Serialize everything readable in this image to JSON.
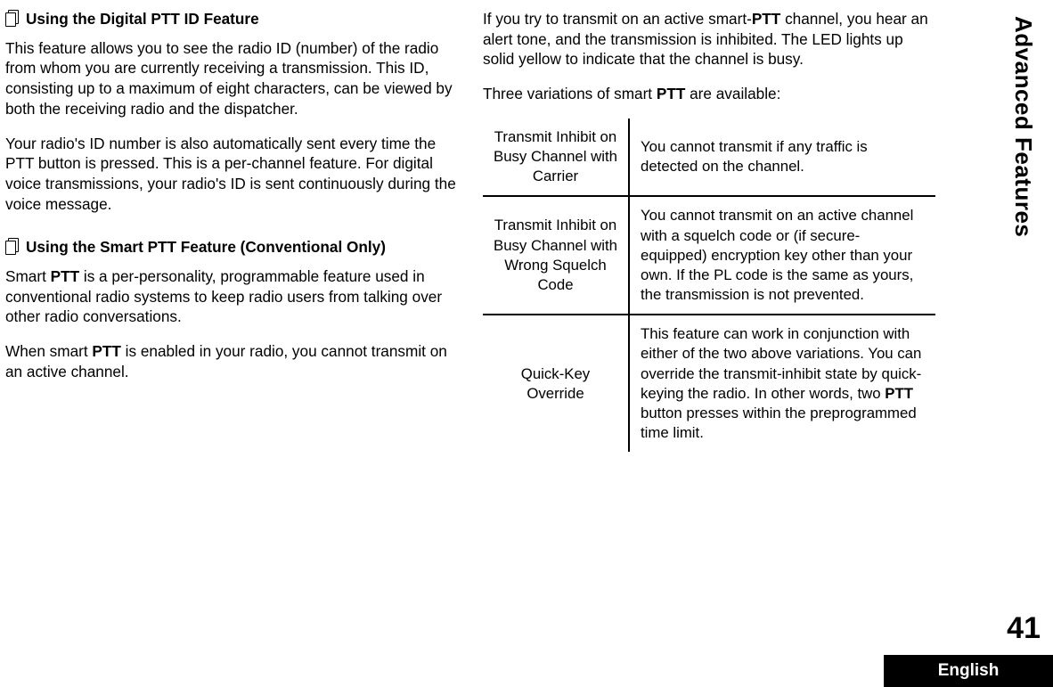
{
  "side_tab": "Advanced Features",
  "page_number": "41",
  "footer_lang": "English",
  "left_col": {
    "heading1": "Using the Digital PTT ID Feature",
    "p1": "This feature allows you to see the radio ID (number) of the radio from whom you are currently receiving a transmission. This ID, consisting up to a maximum of eight characters, can be viewed by both the receiving radio and the dispatcher.",
    "p2": "Your radio's ID number is also automatically sent every time the PTT button is pressed. This is a per-channel feature. For digital voice transmissions, your radio's ID is sent continuously during the voice message.",
    "heading2": "Using the Smart PTT Feature (Conventional Only)",
    "p3a": "Smart ",
    "p3b": "PTT",
    "p3c": " is a per-personality, programmable feature used in conventional radio systems to keep radio users from talking over other radio conversations.",
    "p4a": "When smart ",
    "p4b": "PTT",
    "p4c": " is enabled in your radio, you cannot transmit on an active channel."
  },
  "right_col": {
    "p1a": "If you try to transmit on an active smart-",
    "p1b": "PTT",
    "p1c": " channel, you hear an alert tone, and the transmission is inhibited. The LED lights up solid yellow to indicate that the channel is busy.",
    "p2a": "Three variations of smart ",
    "p2b": "PTT",
    "p2c": " are available:",
    "table": {
      "r1": {
        "left": "Transmit Inhibit on Busy Channel with Carrier",
        "right": "You cannot transmit if any traffic is detected on the channel."
      },
      "r2": {
        "left": "Transmit Inhibit on Busy Channel with Wrong Squelch Code",
        "right": "You cannot transmit on an active channel with a squelch code or (if secure-equipped) encryption key other than your own. If the PL code is the same as yours, the transmission is not prevented."
      },
      "r3": {
        "left": "Quick-Key Override",
        "right_a": "This feature can work in conjunction with either of the two above variations. You can override the transmit-inhibit state by quick-keying the radio. In other words, two ",
        "right_b": "PTT",
        "right_c": " button presses within the preprogrammed time limit."
      }
    }
  }
}
